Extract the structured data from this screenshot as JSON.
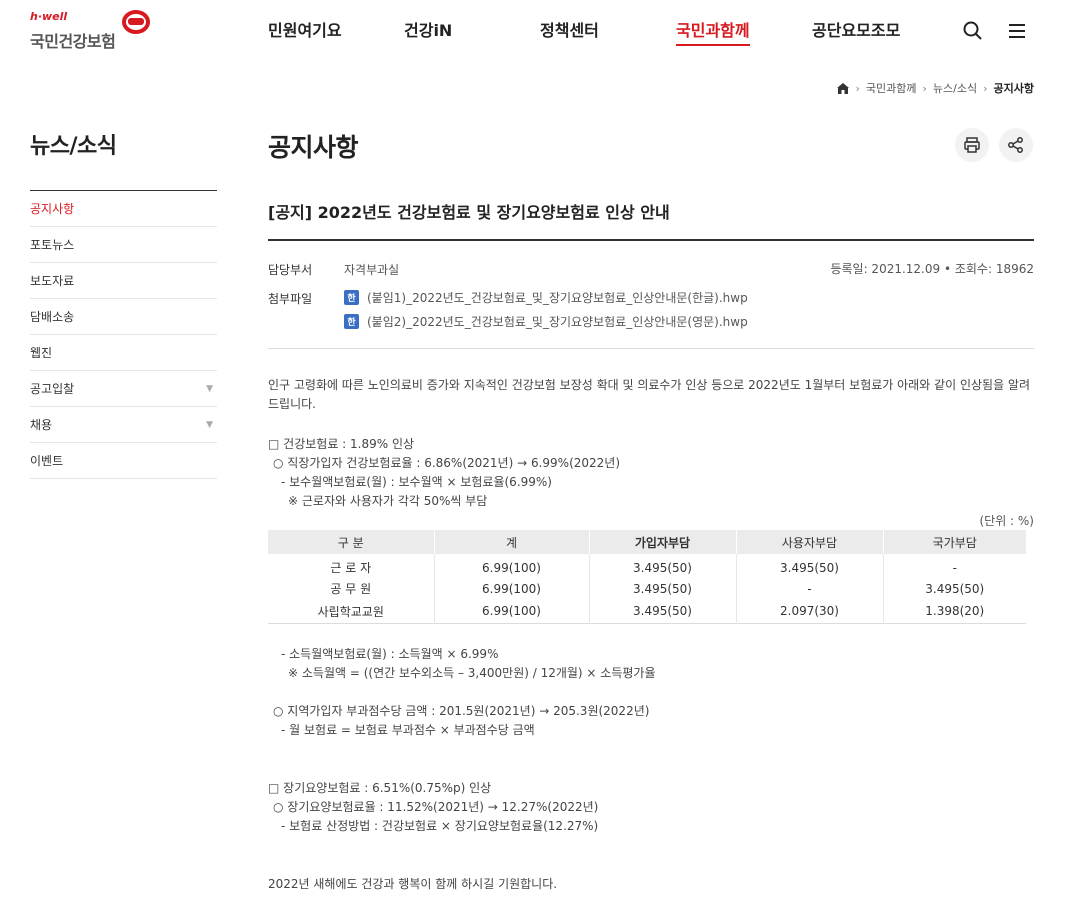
{
  "header": {
    "logo_sub": "h·well",
    "logo_main": "국민건강보험",
    "nav": [
      "민원여기요",
      "건강iN",
      "정책센터",
      "국민과함께",
      "공단요모조모"
    ],
    "active_nav_index": 3,
    "search_icon": "search-icon",
    "menu_icon": "menu-icon",
    "accent_color": "#d71920"
  },
  "breadcrumb": {
    "home_icon": "home-icon",
    "items": [
      "국민과함께",
      "뉴스/소식",
      "공지사항"
    ]
  },
  "sidebar": {
    "title": "뉴스/소식",
    "items": [
      {
        "label": "공지사항"
      },
      {
        "label": "포토뉴스"
      },
      {
        "label": "보도자료"
      },
      {
        "label": "담배소송"
      },
      {
        "label": "웹진"
      },
      {
        "label": "공고입찰"
      },
      {
        "label": "채용"
      },
      {
        "label": "이벤트"
      }
    ]
  },
  "page": {
    "title": "공지사항",
    "print_icon": "print-icon",
    "share_icon": "share-icon"
  },
  "post": {
    "title": "[공지] 2022년도 건강보험료 및 장기요양보험료 인상 안내",
    "dept_label": "담당부서",
    "dept_value": "자격부과실",
    "reg_info": "등록일: 2021.12.09 • 조회수: 18962",
    "attach_label": "첨부파일",
    "attachments": [
      "(붙임1)_2022년도_건강보험료_및_장기요양보험료_인상안내문(한글).hwp",
      "(붙임2)_2022년도_건강보험료_및_장기요양보험료_인상안내문(영문).hwp"
    ],
    "intro": "인구 고령화에 따른 노인의료비 증가와 지속적인 건강보험 보장성 확대 및 의료수가 인상 등으로 2022년도 1월부터 보험료가 아래와 같이 인상됨을 알려드립니다.",
    "health_head": "□ 건강보험료 : 1.89% 인상",
    "health_l1": "○ 직장가입자 건강보험료율 : 6.86%(2021년) → 6.99%(2022년)",
    "health_l2": "- 보수월액보험료(월) : 보수월액 × 보험료율(6.99%)",
    "health_l3": "※ 근로자와 사용자가 각각 50%씩 부담",
    "unit": "(단위 : %)",
    "table_headers": [
      "구 분",
      "계",
      "가입자부담",
      "사용자부담",
      "국가부담"
    ],
    "table_rows": [
      [
        "근 로 자",
        "6.99(100)",
        "3.495(50)",
        "3.495(50)",
        "-"
      ],
      [
        "공 무 원",
        "6.99(100)",
        "3.495(50)",
        "-",
        "3.495(50)"
      ],
      [
        "사립학교교원",
        "6.99(100)",
        "3.495(50)",
        "2.097(30)",
        "1.398(20)"
      ]
    ],
    "after_l1": "- 소득월액보험료(월) : 소득월액 × 6.99%",
    "after_l2": "※ 소득월액 = ((연간 보수외소득 – 3,400만원) / 12개월) × 소득평가율",
    "region_l1": "○ 지역가입자 부과점수당 금액 : 201.5원(2021년) → 205.3원(2022년)",
    "region_l2": "- 월 보험료 = 보험료 부과점수 × 부과점수당 금액",
    "ltc_head": "□ 장기요양보험료 : 6.51%(0.75%p) 인상",
    "ltc_l1": "○ 장기요양보험료율 : 11.52%(2021년) → 12.27%(2022년)",
    "ltc_l2": "- 보험료 산정방법 : 건강보험료 × 장기요양보험료율(12.27%)",
    "closing": "2022년 새해에도 건강과 행복이 함께 하시길 기원합니다."
  }
}
